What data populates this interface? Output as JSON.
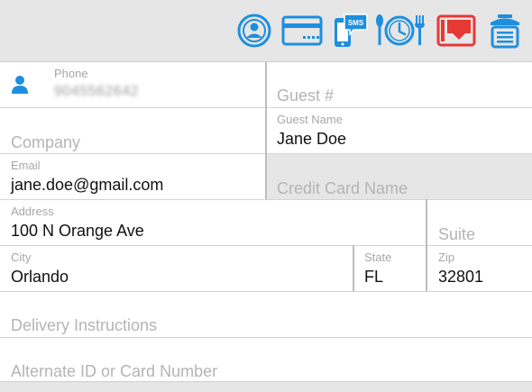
{
  "toolbar": {
    "icons": [
      {
        "name": "loyalty-badge-icon",
        "color": "#1e8fde"
      },
      {
        "name": "credit-card-icon",
        "color": "#1e8fde"
      },
      {
        "name": "sms-phone-icon",
        "color": "#1e8fde",
        "text": "SMS"
      },
      {
        "name": "dining-clock-icon",
        "color": "#1e8fde"
      },
      {
        "name": "gift-card-icon",
        "color": "#e53935"
      },
      {
        "name": "reception-bell-icon",
        "color": "#1e8fde"
      }
    ]
  },
  "form": {
    "phone": {
      "label": "Phone",
      "value": "9045562642"
    },
    "guest_number": {
      "placeholder": "Guest #"
    },
    "company": {
      "placeholder": "Company"
    },
    "guest_name": {
      "label": "Guest Name",
      "value": "Jane Doe"
    },
    "email": {
      "label": "Email",
      "value": "jane.doe@gmail.com"
    },
    "credit_card_name": {
      "placeholder": "Credit Card Name"
    },
    "address": {
      "label": "Address",
      "value": "100 N Orange Ave"
    },
    "suite": {
      "placeholder": "Suite"
    },
    "city": {
      "label": "City",
      "value": "Orlando"
    },
    "state": {
      "label": "State",
      "value": "FL"
    },
    "zip": {
      "label": "Zip",
      "value": "32801"
    },
    "delivery_instructions": {
      "placeholder": "Delivery Instructions"
    },
    "alternate_id": {
      "placeholder": "Alternate ID or Card Number"
    }
  },
  "colors": {
    "accent": "#1e8fde",
    "danger": "#e53935"
  }
}
